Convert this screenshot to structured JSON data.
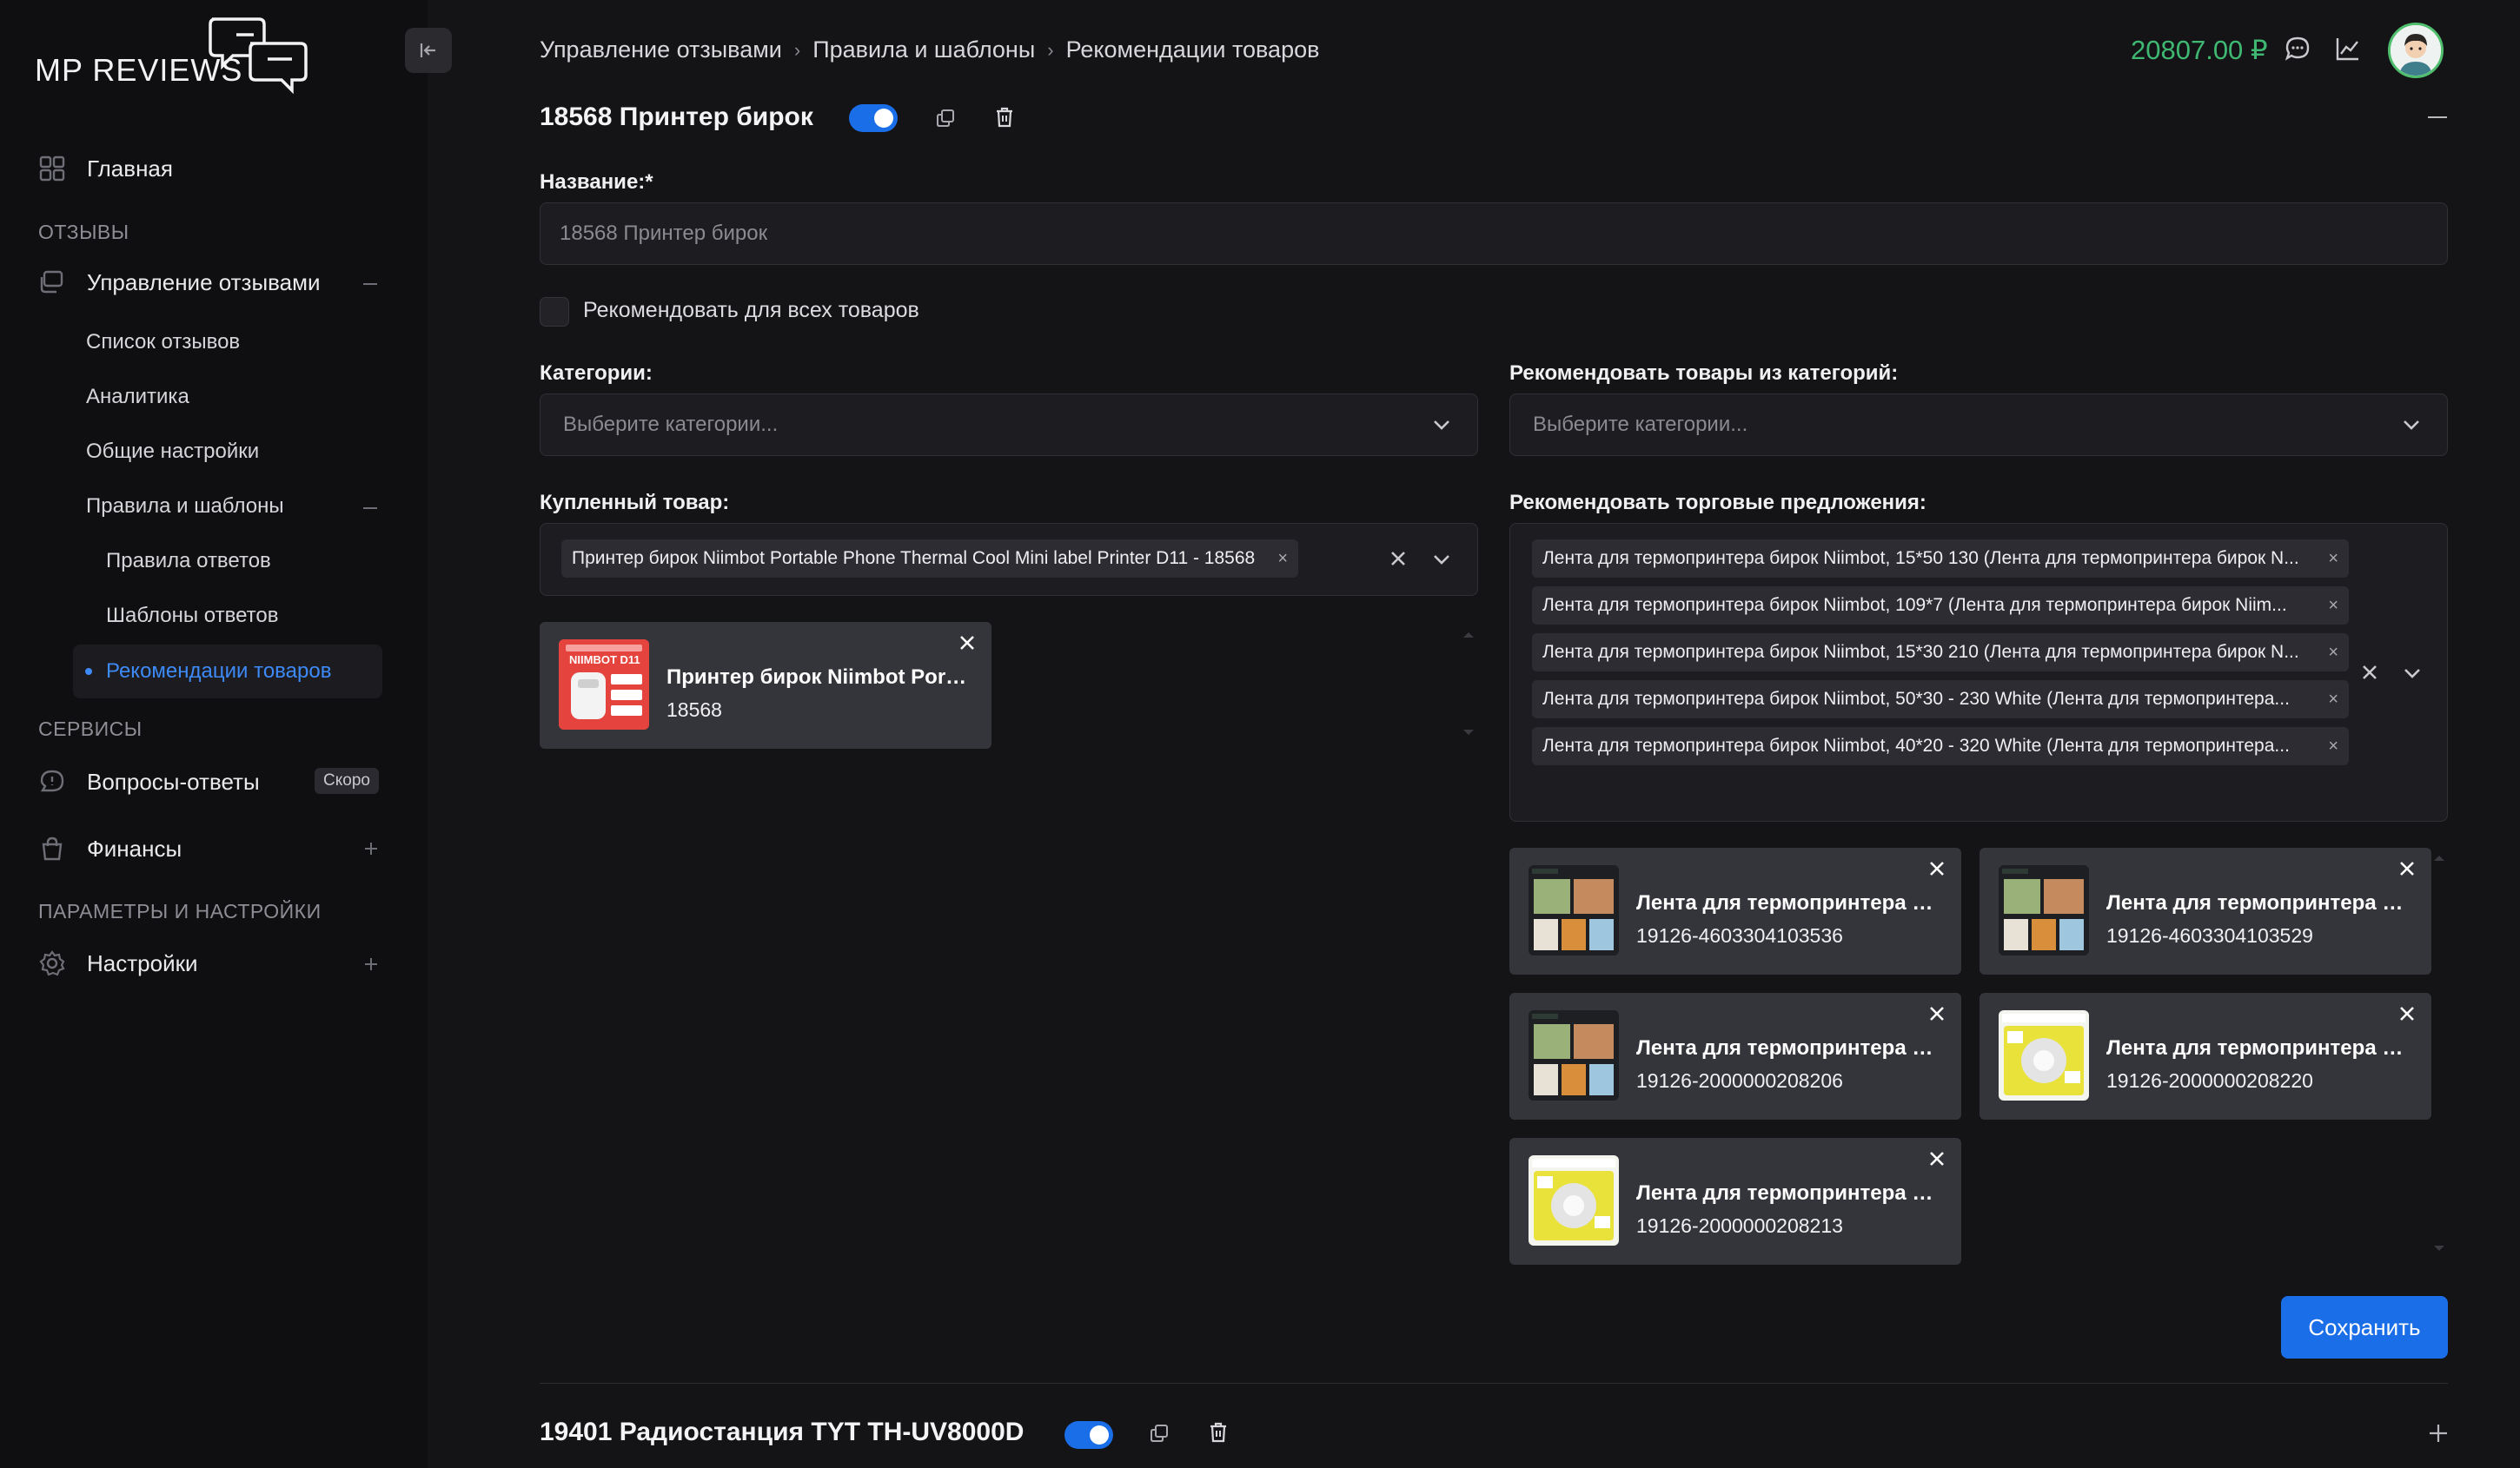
{
  "app": {
    "logo_text": "MP REVIEWS"
  },
  "sidebar": {
    "home": "Главная",
    "section_reviews": "ОТЗЫВЫ",
    "reviews_management": "Управление отзывами",
    "reviews_list": "Список отзывов",
    "analytics": "Аналитика",
    "general_settings": "Общие настройки",
    "rules_templates": "Правила и шаблоны",
    "answer_rules": "Правила ответов",
    "answer_templates": "Шаблоны ответов",
    "product_recommendations": "Рекомендации товаров",
    "section_services": "СЕРВИСЫ",
    "qa": "Вопросы-ответы",
    "qa_badge": "Скоро",
    "finance": "Финансы",
    "section_settings": "ПАРАМЕТРЫ И НАСТРОЙКИ",
    "settings": "Настройки"
  },
  "breadcrumb": [
    "Управление отзывами",
    "Правила и шаблоны",
    "Рекомендации товаров"
  ],
  "header": {
    "balance": "20807.00 ₽"
  },
  "rule": {
    "title": "18568 Принтер бирок",
    "enabled": true,
    "name_label": "Название:*",
    "name_value": "18568 Принтер бирок",
    "recommend_all_label": "Рекомендовать для всех товаров",
    "categories_label": "Категории:",
    "categories_placeholder": "Выберите категории...",
    "rec_categories_label": "Рекомендовать товары из категорий:",
    "rec_categories_placeholder": "Выберите категории...",
    "purchased_label": "Купленный товар:",
    "purchased_chip": "Принтер бирок Niimbot Portable Phone Thermal Cool Mini label Printer D11 - 18568",
    "purchased_card": {
      "title": "Принтер бирок Niimbot Portab...",
      "sku": "18568",
      "thumb_text": "NIIMBOT D11"
    },
    "offers_label": "Рекомендовать торговые предложения:",
    "offer_chips": [
      "Лента для термопринтера бирок Niimbot, 15*50 130 (Лента для термопринтера бирок N...",
      "Лента для термопринтера бирок Niimbot, 109*7 (Лента для термопринтера бирок Niim...",
      "Лента для термопринтера бирок Niimbot, 15*30 210 (Лента для термопринтера бирок N...",
      "Лента для термопринтера бирок Niimbot, 50*30 - 230 White (Лента для термопринтера...",
      "Лента для термопринтера бирок Niimbot, 40*20 - 320 White (Лента для термопринтера..."
    ],
    "offer_cards": [
      {
        "title": "Лента для термопринтера би...",
        "sku": "19126-4603304103536",
        "thumb": "grid"
      },
      {
        "title": "Лента для термопринтера би...",
        "sku": "19126-4603304103529",
        "thumb": "grid"
      },
      {
        "title": "Лента для термопринтера би...",
        "sku": "19126-2000000208206",
        "thumb": "grid"
      },
      {
        "title": "Лента для термопринтера би...",
        "sku": "19126-2000000208220",
        "thumb": "yellow"
      },
      {
        "title": "Лента для термопринтера би...",
        "sku": "19126-2000000208213",
        "thumb": "yellow"
      }
    ],
    "save_label": "Сохранить"
  },
  "next_rule": {
    "title": "19401 Радиостанция TYT TH-UV8000D",
    "enabled": true
  },
  "colors": {
    "accent": "#1a6ee8",
    "balance": "#3fb872",
    "active_nav": "#3e8af7"
  }
}
